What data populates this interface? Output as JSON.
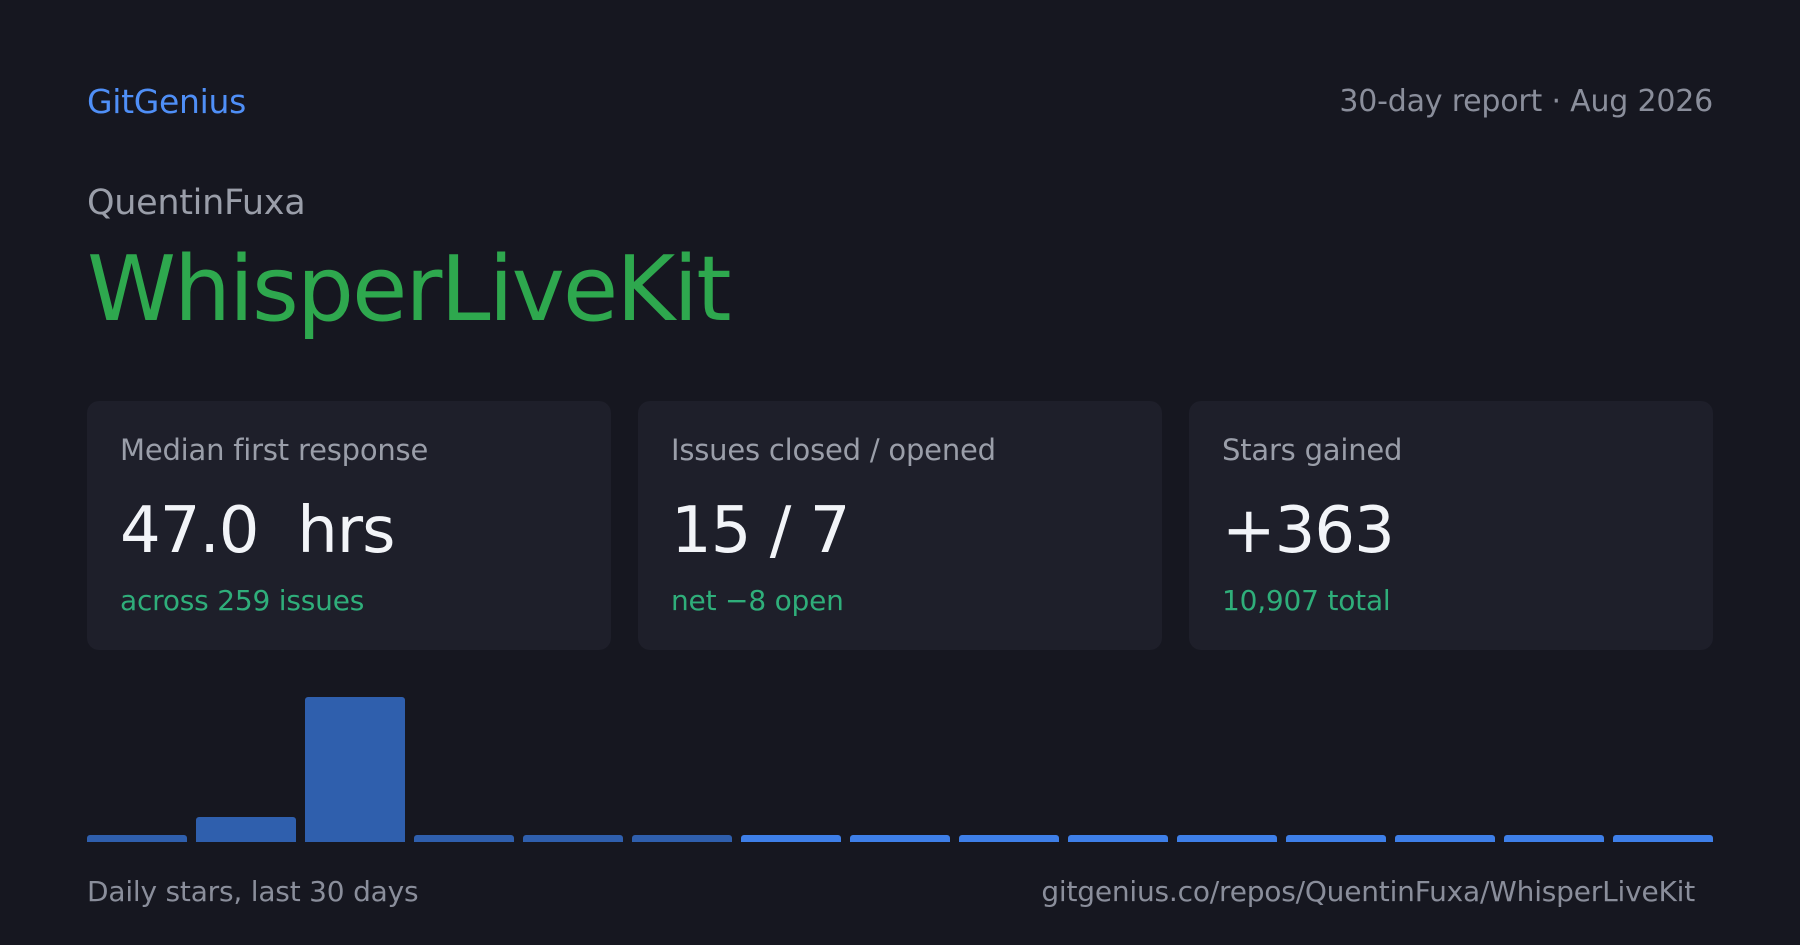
{
  "header": {
    "brand": "GitGenius",
    "report_label": "30-day report · Aug 2026"
  },
  "repo": {
    "owner": "QuentinFuxa",
    "name": "WhisperLiveKit"
  },
  "cards": [
    {
      "label": "Median first response",
      "value": "47.0  hrs",
      "sub": "across 259 issues"
    },
    {
      "label": "Issues closed / opened",
      "value": "15 / 7",
      "sub": "net −8 open"
    },
    {
      "label": "Stars gained",
      "value": "+363",
      "sub": "10,907 total"
    }
  ],
  "chart_data": {
    "type": "bar",
    "title": "",
    "xlabel": "",
    "ylabel": "",
    "values": [
      1,
      5,
      29,
      1,
      1,
      1,
      1,
      1,
      1,
      1,
      1,
      1,
      1,
      1,
      1
    ],
    "ylim": [
      0,
      29
    ],
    "grid": false,
    "legend": "none",
    "colors": {
      "dim": "#2f5fad",
      "bright": "#3e7fe8"
    }
  },
  "footer": {
    "caption": "Daily stars, last 30 days",
    "url": "gitgenius.co/repos/QuentinFuxa/WhisperLiveKit"
  }
}
